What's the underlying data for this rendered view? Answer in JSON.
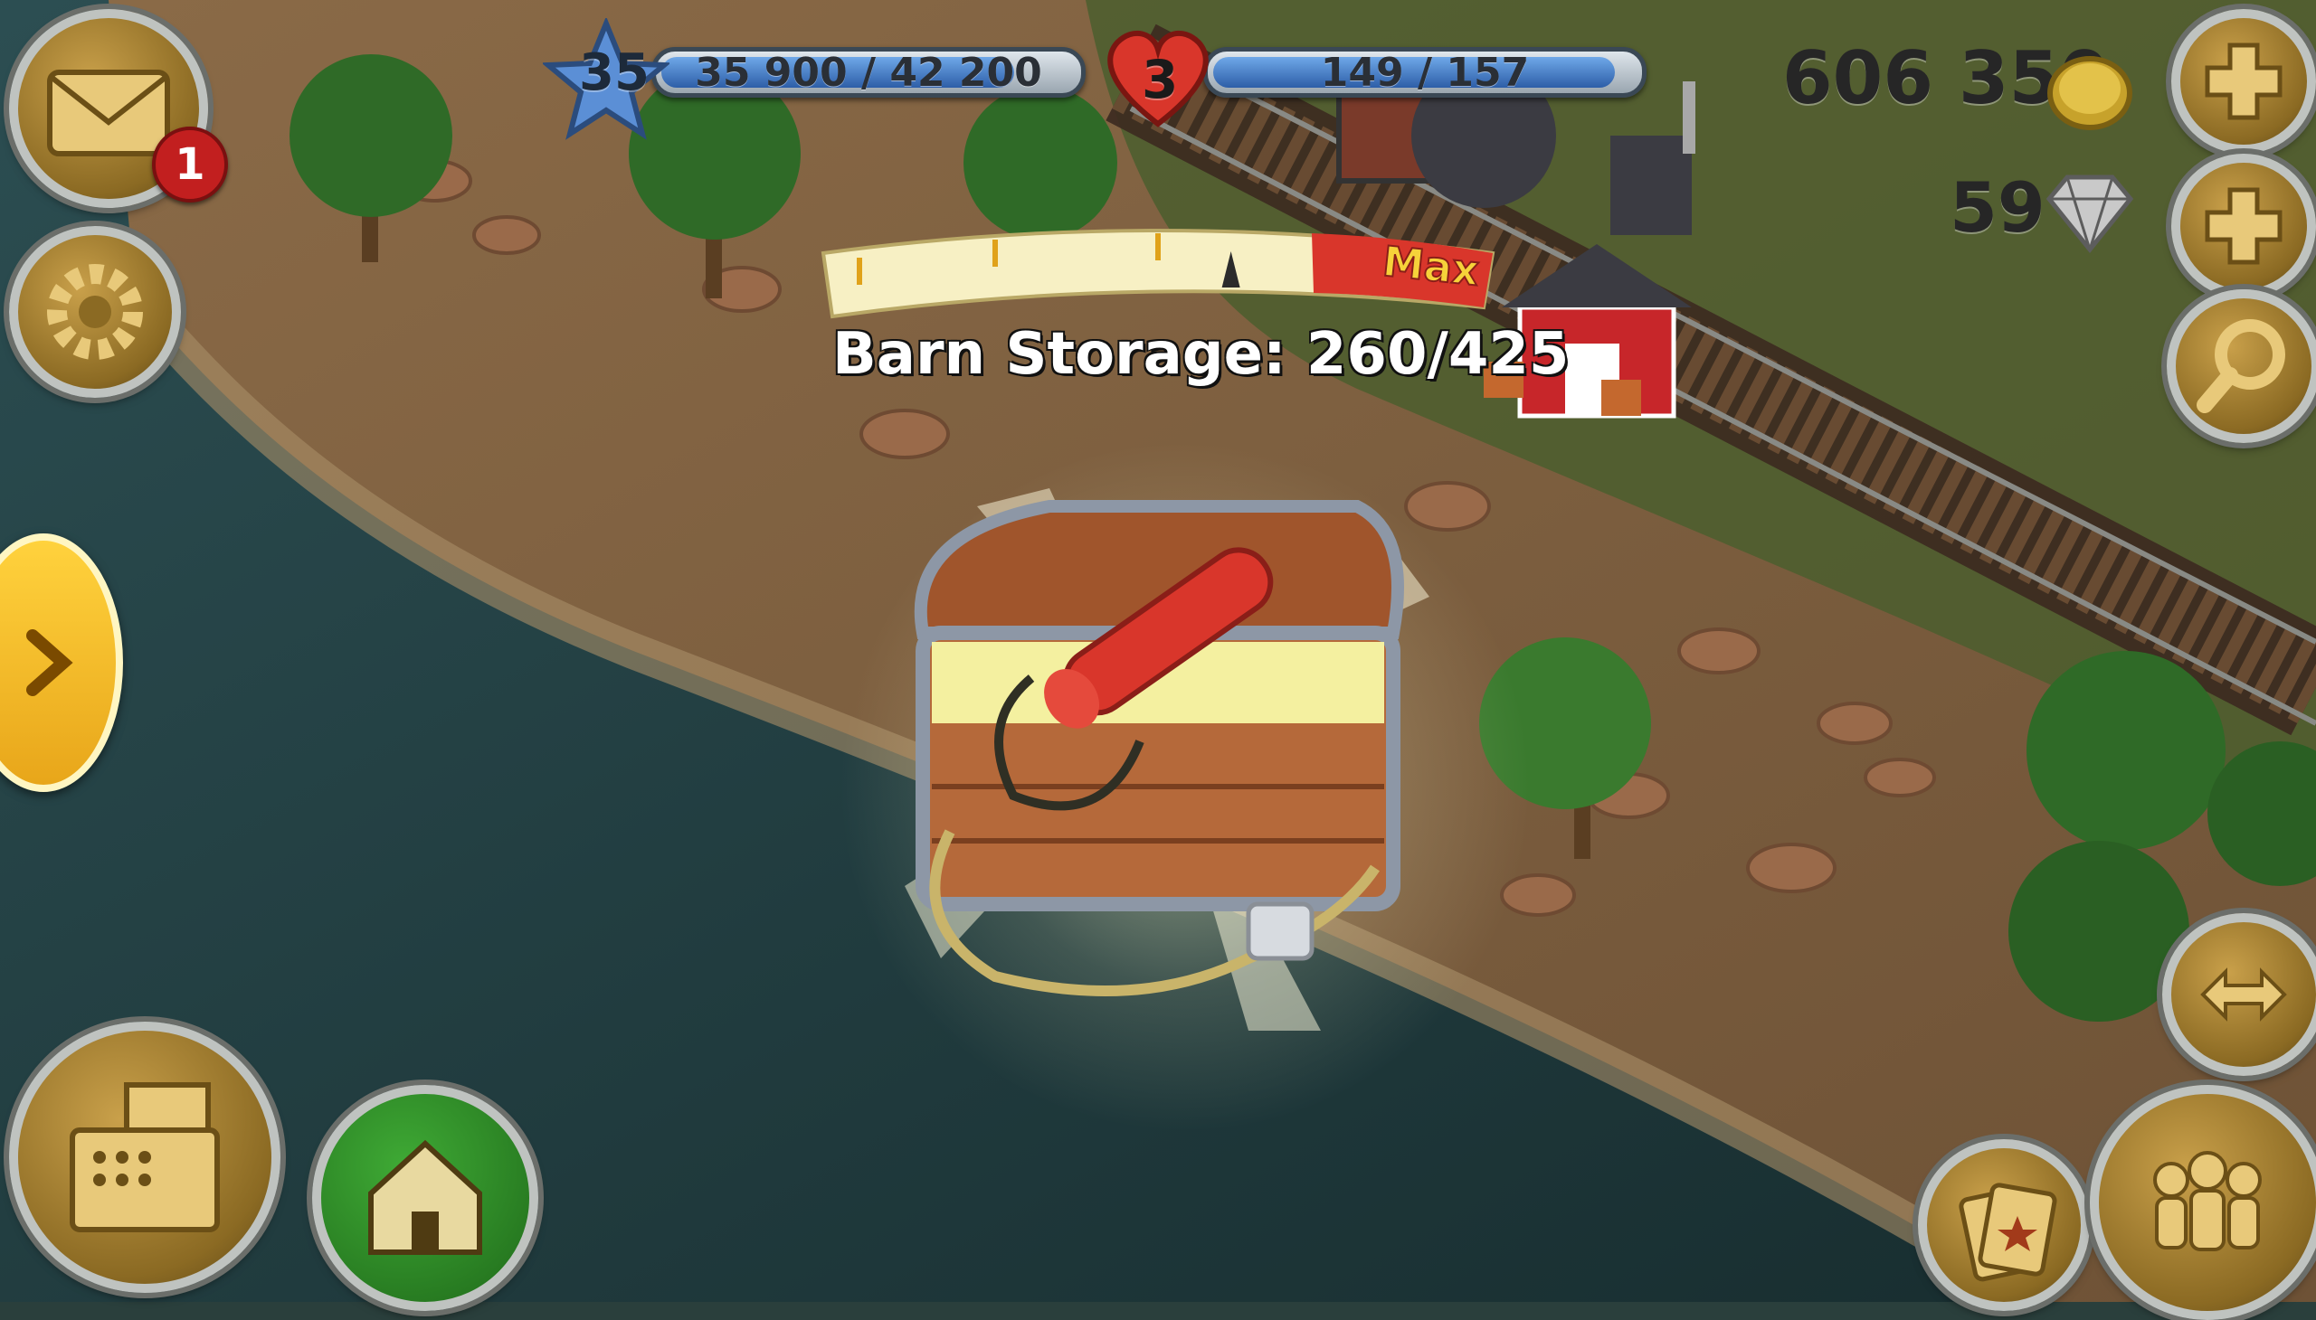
{
  "hud": {
    "level": "35",
    "xp_text": "35 900 / 42 200",
    "xp_progress": 0.851,
    "lives": "3",
    "energy_text": "149 / 157",
    "energy_progress": 0.949,
    "coins": "606 350",
    "diamonds": "59",
    "mail_badge": "1"
  },
  "storage_meter": {
    "max_label": "Max",
    "storage_text": "Barn Storage: 260/425",
    "fill_fraction": 0.612
  },
  "icons": {
    "mail": "mail-icon",
    "settings": "gear-icon",
    "add_coins": "plus-icon",
    "add_diamonds": "plus-icon",
    "search": "magnifier-icon",
    "expand": "chevron-right-icon",
    "shop": "cash-register-icon",
    "home": "house-icon",
    "edit": "expand-arrows-icon",
    "cards": "cards-icon",
    "friends": "people-icon"
  },
  "colors": {
    "accent_gold": "#c9a04a",
    "water": "#1f3a3d",
    "max_red": "#d9362b",
    "max_text": "#f6d23a"
  }
}
